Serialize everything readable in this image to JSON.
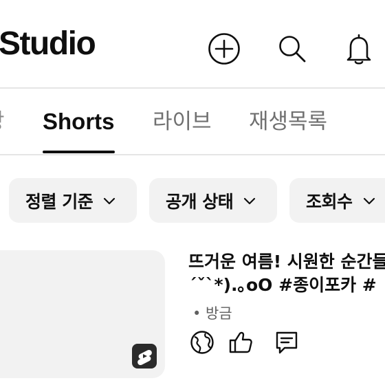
{
  "header": {
    "title": "Studio",
    "icons": [
      "add-circle-icon",
      "search-icon",
      "bell-icon"
    ]
  },
  "tabs": [
    {
      "label": "상",
      "active": false
    },
    {
      "label": "Shorts",
      "active": true
    },
    {
      "label": "라이브",
      "active": false
    },
    {
      "label": "재생목록",
      "active": false
    }
  ],
  "filters": [
    {
      "label": "정렬 기준"
    },
    {
      "label": "공개 상태"
    },
    {
      "label": "조회수"
    }
  ],
  "video": {
    "title_line1": "뜨거운 여름! 시원한 순간들",
    "title_line2": "´ˇ`*).｡oO #종이포카 #",
    "meta": "• 방금",
    "icons": [
      "globe-icon",
      "thumbs-up-icon",
      "comment-icon"
    ],
    "badge": "shorts-logo-icon"
  },
  "colors": {
    "active_text": "#0f0f0f",
    "inactive_tab": "#707070",
    "chip_bg": "#f2f2f2",
    "meta_text": "#606060"
  }
}
